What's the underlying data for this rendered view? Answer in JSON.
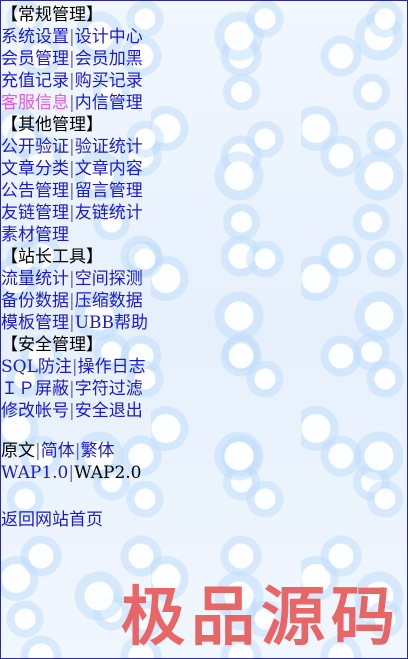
{
  "sections": [
    {
      "title": "【常规管理】",
      "rows": [
        [
          "系统设置",
          "设计中心"
        ],
        [
          "会员管理",
          "会员加黑"
        ],
        [
          "充值记录",
          "购买记录"
        ],
        [
          "客服信息",
          "内信管理"
        ]
      ]
    },
    {
      "title": "【其他管理】",
      "rows": [
        [
          "公开验证",
          "验证统计"
        ],
        [
          "文章分类",
          "文章内容"
        ],
        [
          "公告管理",
          "留言管理"
        ],
        [
          "友链管理",
          "友链统计"
        ],
        [
          "素材管理"
        ]
      ]
    },
    {
      "title": "【站长工具】",
      "rows": [
        [
          "流量统计",
          "空间探测"
        ],
        [
          "备份数据",
          "压缩数据"
        ],
        [
          "模板管理",
          "UBB帮助"
        ]
      ]
    },
    {
      "title": "【安全管理】",
      "rows": [
        [
          "SQL防注",
          "操作日志"
        ],
        [
          "ＩＰ屏蔽",
          "字符过滤"
        ],
        [
          "修改帐号",
          "安全退出"
        ]
      ]
    }
  ],
  "lang": {
    "items": [
      "原文",
      "简体",
      "繁体"
    ]
  },
  "wap": {
    "items": [
      "WAP1.0",
      "WAP2.0"
    ]
  },
  "footer": {
    "home_link": "返回网站首页"
  },
  "separator": "|",
  "watermark": "极品源码",
  "colors": {
    "link": "#1a1ad0",
    "visited_link": "#e05adf",
    "watermark": "#e85a5a",
    "border": "#2a2aa0"
  }
}
